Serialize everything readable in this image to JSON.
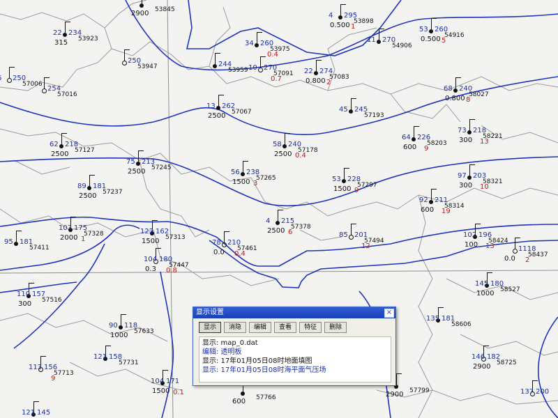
{
  "dialog": {
    "title": "显示设置",
    "close_glyph": "×",
    "buttons": [
      "显示",
      "消隐",
      "编辑",
      "查看",
      "特征",
      "删除"
    ],
    "log": [
      "显示: map_0.dat",
      "编辑: 透明板",
      "显示: 17年01月05日08时地面填图",
      "显示: 17年01月05日08时海平面气压场"
    ]
  },
  "colors": {
    "isobar": "#1f33b8",
    "border": "#9a9a9a",
    "text": "#111111",
    "precip": "#c01818",
    "dialog_title": "#1841b8"
  },
  "stations": [
    {
      "id": "53845",
      "t": "",
      "p": "",
      "v": "2900",
      "r": "",
      "shape": "dot"
    },
    {
      "id": "53898",
      "t": "4",
      "p": "295",
      "v": "0.500",
      "r": "1",
      "shape": "dot"
    },
    {
      "id": "53923",
      "t": "22",
      "p": "234",
      "v": "315",
      "r": "",
      "shape": "dot"
    },
    {
      "id": "53947",
      "t": "",
      "p": "250",
      "v": "",
      "r": "",
      "shape": "hollow"
    },
    {
      "id": "53959",
      "t": "",
      "p": "244",
      "v": "",
      "r": "",
      "shape": "dot"
    },
    {
      "id": "53975",
      "t": "34",
      "p": "260",
      "v": "",
      "r": "0.4",
      "shape": "dot"
    },
    {
      "id": "54916",
      "t": "53",
      "p": "260",
      "v": "0.500",
      "r": "5",
      "shape": "dot"
    },
    {
      "id": "54906",
      "t": "11",
      "p": "270",
      "v": "",
      "r": "",
      "shape": "dot"
    },
    {
      "id": "57006",
      "t": "6",
      "p": "250",
      "v": "",
      "r": "",
      "shape": "hollow"
    },
    {
      "id": "57016",
      "t": "",
      "p": "254",
      "v": "",
      "r": "",
      "shape": "hollow"
    },
    {
      "id": "57091",
      "t": "10",
      "p": "270",
      "v": "",
      "r": "0.7",
      "shape": "hollow"
    },
    {
      "id": "57083",
      "t": "22",
      "p": "274",
      "v": "0.800",
      "r": "2",
      "shape": "dot"
    },
    {
      "id": "57067",
      "t": "13",
      "p": "262",
      "v": "2500",
      "r": "",
      "shape": "dot"
    },
    {
      "id": "57193",
      "t": "45",
      "p": "245",
      "v": "",
      "r": "",
      "shape": "dot"
    },
    {
      "id": "58027",
      "t": "68",
      "p": "240",
      "v": "0.800",
      "r": "8",
      "shape": "dot"
    },
    {
      "id": "58221",
      "t": "73",
      "p": "218",
      "v": "300",
      "r": "13",
      "shape": "dot"
    },
    {
      "id": "57127",
      "t": "62",
      "p": "218",
      "v": "2500",
      "r": "",
      "shape": "dot"
    },
    {
      "id": "57178",
      "t": "58",
      "p": "240",
      "v": "2500",
      "r": "0.4",
      "shape": "dot"
    },
    {
      "id": "57245",
      "t": "75",
      "p": "213",
      "v": "2500",
      "r": "",
      "shape": "dot"
    },
    {
      "id": "58203",
      "t": "64",
      "p": "226",
      "v": "600",
      "r": "9",
      "shape": "dot"
    },
    {
      "id": "57265",
      "t": "56",
      "p": "238",
      "v": "1500",
      "r": "3",
      "shape": "dot"
    },
    {
      "id": "57297",
      "t": "53",
      "p": "228",
      "v": "1500",
      "r": "9",
      "shape": "dot"
    },
    {
      "id": "58321",
      "t": "97",
      "p": "203",
      "v": "300",
      "r": "10",
      "shape": "dot"
    },
    {
      "id": "57237",
      "t": "89",
      "p": "181",
      "v": "2500",
      "r": "",
      "shape": "dot"
    },
    {
      "id": "58314",
      "t": "92",
      "p": "211",
      "v": "600",
      "r": "19",
      "shape": "dot"
    },
    {
      "id": "57328",
      "t": "103",
      "p": "175",
      "v": "2000",
      "r": "1",
      "shape": "dot"
    },
    {
      "id": "57378",
      "t": "4",
      "p": "215",
      "v": "2500",
      "r": "6",
      "shape": "dot"
    },
    {
      "id": "57411",
      "t": "95",
      "p": "181",
      "v": "",
      "r": "",
      "shape": "dot"
    },
    {
      "id": "57313",
      "t": "122",
      "p": "162",
      "v": "1500",
      "r": "",
      "shape": "dot"
    },
    {
      "id": "57461",
      "t": "78",
      "p": "210",
      "v": "0.0",
      "r": "0.4",
      "shape": "hollow"
    },
    {
      "id": "57494",
      "t": "85",
      "p": "201",
      "v": "",
      "r": "12",
      "shape": "hollow"
    },
    {
      "id": "58424",
      "t": "102",
      "p": "196",
      "v": "100",
      "r": "13",
      "shape": "dot"
    },
    {
      "id": "58437",
      "t": "",
      "p": "1118",
      "v": "0.0",
      "r": "2",
      "shape": "hollow"
    },
    {
      "id": "57447",
      "t": "104",
      "p": "180",
      "v": "0.3",
      "r": "0.8",
      "shape": "hollow"
    },
    {
      "id": "57516",
      "t": "110",
      "p": "157",
      "v": "300",
      "r": "",
      "shape": "dot"
    },
    {
      "id": "58527",
      "t": "145",
      "p": "180",
      "v": "1000",
      "r": "",
      "shape": "dot"
    },
    {
      "id": "57633",
      "t": "90",
      "p": "118",
      "v": "1000",
      "r": "",
      "shape": "dot"
    },
    {
      "id": "58606",
      "t": "135",
      "p": "181",
      "v": "",
      "r": "",
      "shape": "dot"
    },
    {
      "id": "57731",
      "t": "121",
      "p": "158",
      "v": "",
      "r": "",
      "shape": "dot"
    },
    {
      "id": "57713",
      "t": "113",
      "p": "156",
      "v": "",
      "r": "9",
      "shape": "hollow"
    },
    {
      "id": "57766",
      "t": "",
      "p": "",
      "v": "600",
      "r": "",
      "shape": "dot"
    },
    {
      "id": "57799",
      "t": "",
      "p": "",
      "v": "2900",
      "r": "",
      "shape": "dot"
    },
    {
      "id": "58725",
      "t": "146",
      "p": "182",
      "v": "2900",
      "r": "",
      "shape": "hollow"
    },
    {
      "id": "",
      "t": "104",
      "p": "171",
      "v": "1500",
      "r": "0.1",
      "shape": "dot"
    },
    {
      "id": "",
      "t": "137",
      "p": "200",
      "v": "",
      "r": "",
      "shape": "hollow"
    },
    {
      "id": "",
      "t": "121",
      "p": "145",
      "v": "",
      "r": "",
      "shape": "dot"
    }
  ]
}
